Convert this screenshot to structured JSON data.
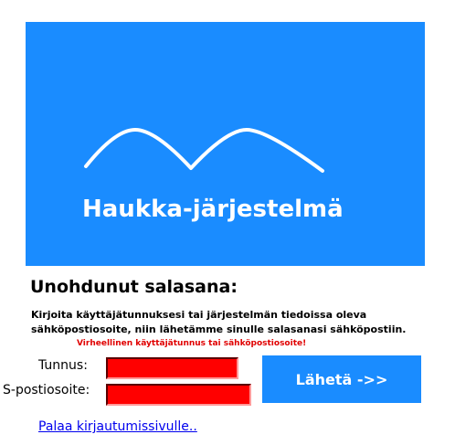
{
  "banner": {
    "logo_icon": "mountain-wave-logo-icon",
    "title": "Haukka-järjestelmä",
    "background_color": "#1a8cff"
  },
  "form": {
    "title": "Unohdunut salasana:",
    "instructions": "Kirjoita käyttäjätunnuksesi tai järjestelmän tiedoissa oleva sähköpostiosoite, niin lähetämme sinulle salasanasi sähköpostiin.",
    "error": "Virheellinen käyttäjätunnus tai sähköpostiosoite!",
    "username_label": "Tunnus:",
    "username_value": "",
    "email_label": "S-postiosoite:",
    "email_value": "",
    "submit_label": "Lähetä ->>",
    "field_error_color": "#ff0000",
    "error_text_color": "#e00000"
  },
  "back_link": {
    "label": "Palaa kirjautumissivulle.."
  }
}
